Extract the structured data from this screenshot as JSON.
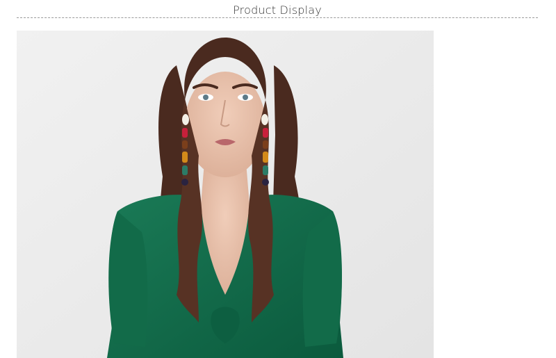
{
  "section": {
    "title": "Product Display"
  },
  "colors": {
    "background": "#ffffff",
    "title_text": "#333333",
    "divider": "#9a9a9a",
    "photo_backdrop": "#ececec",
    "dress": "#0e6b4a",
    "hair": "#4a2a1f",
    "skin": "#e9c3ae"
  }
}
